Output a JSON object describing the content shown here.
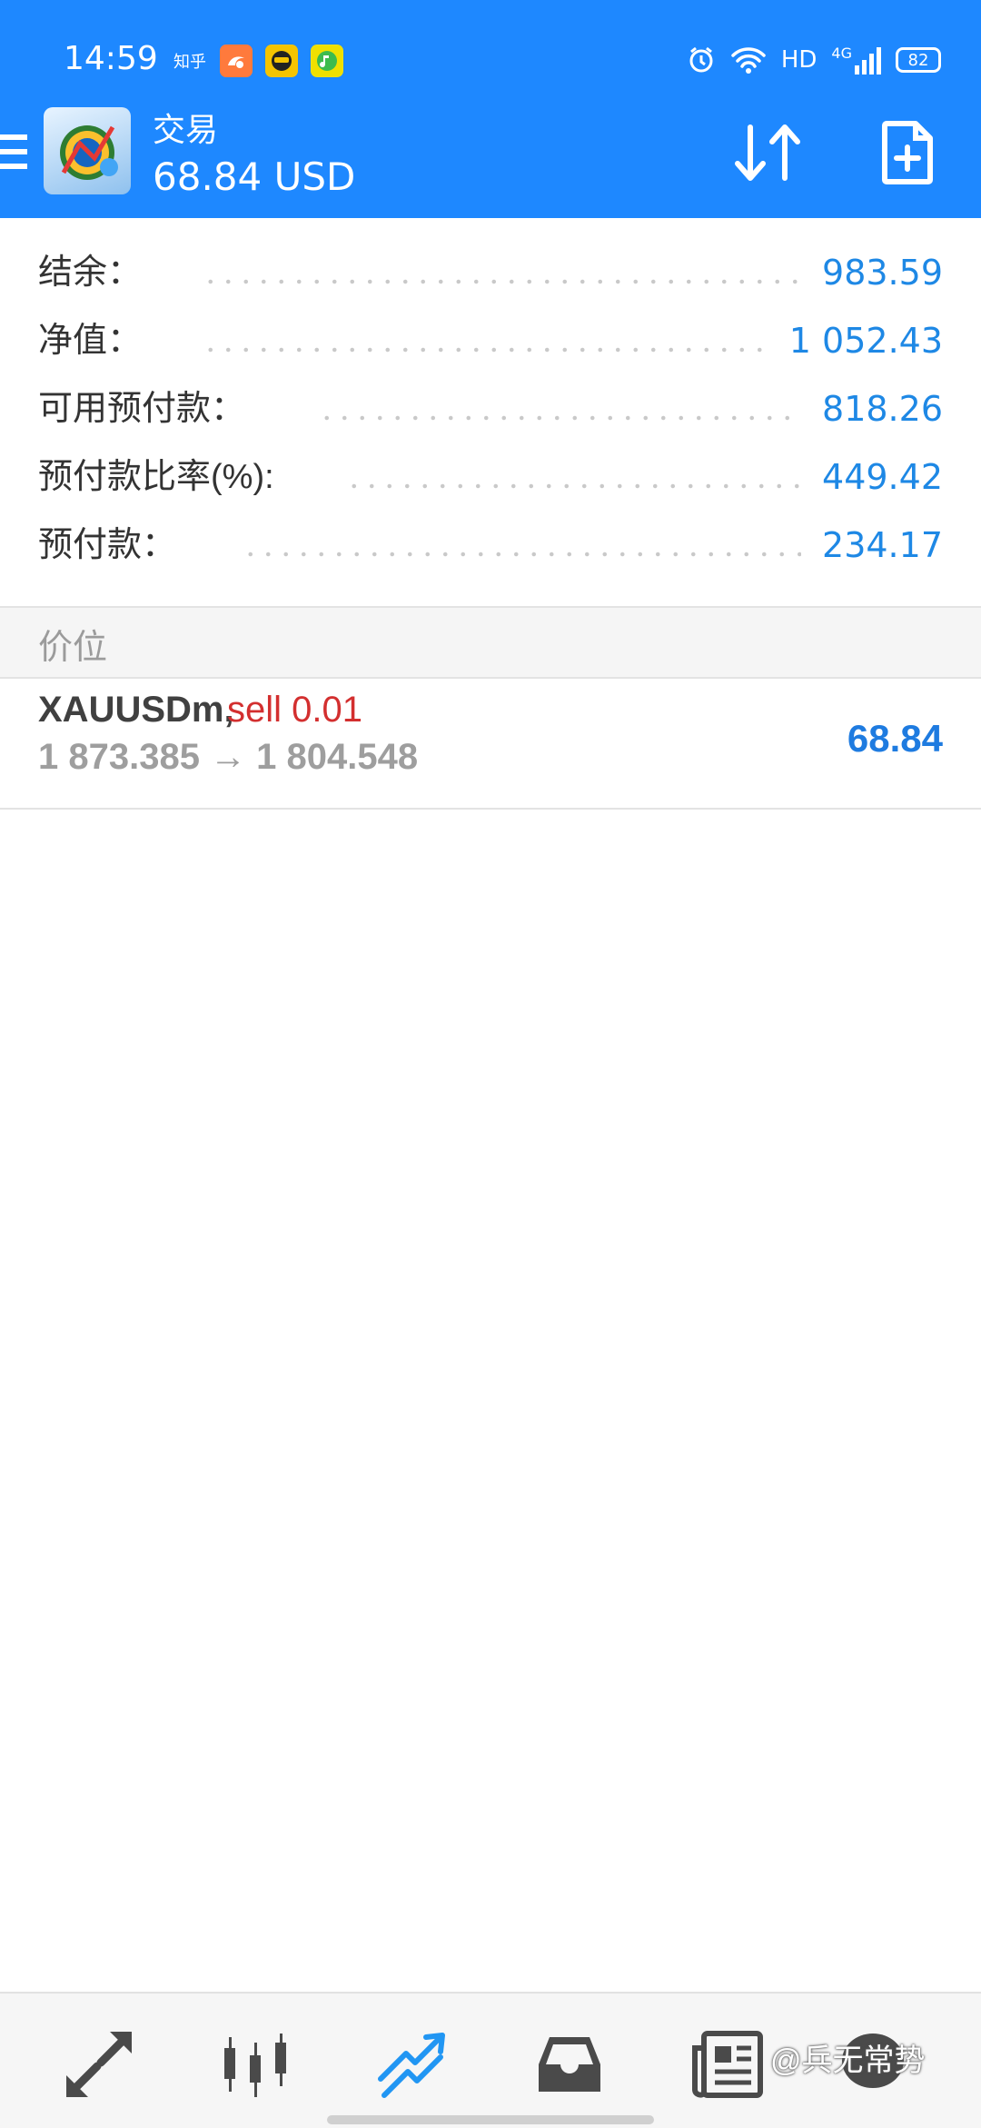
{
  "status_bar": {
    "time": "14:59",
    "apps": [
      "zhihu",
      "uc-browser",
      "game-avatar",
      "qq-music"
    ],
    "zhihu_label": "知乎",
    "hd_label": "HD",
    "network_label": "4G",
    "battery_level": "82"
  },
  "header": {
    "title": "交易",
    "balance_display": "68.84 USD"
  },
  "summary": {
    "rows": [
      {
        "label": "结余：",
        "value": "983.59"
      },
      {
        "label": "净值：",
        "value": "1 052.43"
      },
      {
        "label": "可用预付款：",
        "value": "818.26"
      },
      {
        "label": "预付款比率(%):",
        "value": "449.42"
      },
      {
        "label": "预付款：",
        "value": "234.17"
      }
    ]
  },
  "positions_section": {
    "title": "价位"
  },
  "positions": [
    {
      "symbol": "XAUUSDm,",
      "side": "sell 0.01",
      "prices": "1 873.385 → 1 804.548",
      "profit": "68.84"
    }
  ],
  "bottom_nav": {
    "items": [
      "quotes",
      "chart",
      "trade",
      "history",
      "news",
      "chat"
    ],
    "active": "trade"
  },
  "watermark": "@兵无常势",
  "colors": {
    "header_bg": "#1e88ff",
    "value_blue": "#1e88e5",
    "sell_red": "#d32f2f",
    "profit_blue": "#1e7be0"
  }
}
